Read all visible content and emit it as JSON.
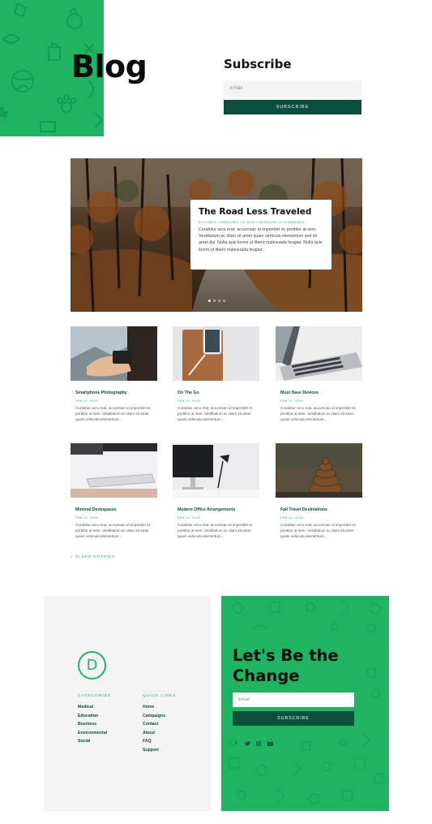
{
  "header": {
    "page_title": "Blog",
    "subscribe": {
      "title": "Subscribe",
      "email_placeholder": "Email",
      "button_label": "SUBSCRIBE"
    }
  },
  "featured": {
    "title": "The Road Less Traveled",
    "meta": "BY ETREX | FEBRUARY 13, 2019 | OUTDOOR | 0 COMMENTS",
    "excerpt": "Curabitur arcu erat, accumsan id imperdiet et, porttitor at sem. Vestibulum ac diam sit amet quam vehicula elementum sed sit amet dui. Nulla quis lorem ut libero malesuada feugiat. Nulla quis lorem ut libero malesuada feugiat.",
    "slides": 4,
    "active_slide": 1
  },
  "posts": [
    {
      "title": "Smartphone Photography",
      "date": "FEB 13, 2019",
      "excerpt": "Curabitur arcu erat, accumsan id imperdiet et, porttitor at sem. Vestibulum ac diam sit amet quam vehicula elementum..."
    },
    {
      "title": "On The Go",
      "date": "FEB 13, 2019",
      "excerpt": "Curabitur arcu erat, accumsan id imperdiet et, porttitor at sem. Vestibulum ac diam sit amet quam vehicula elementum..."
    },
    {
      "title": "Must Have Devices",
      "date": "FEB 13, 2019",
      "excerpt": "Curabitur arcu erat, accumsan id imperdiet et, porttitor at sem. Vestibulum ac diam sit amet quam vehicula elementum..."
    },
    {
      "title": "Minimal Deskspaces",
      "date": "FEB 13, 2019",
      "excerpt": "Curabitur arcu erat, accumsan id imperdiet et, porttitor at sem. Vestibulum ac diam sit amet quam vehicula elementum..."
    },
    {
      "title": "Modern Office Arrangements",
      "date": "FEB 13, 2019",
      "excerpt": "Curabitur arcu erat, accumsan id imperdiet et, porttitor at sem. Vestibulum ac diam sit amet quam vehicula elementum..."
    },
    {
      "title": "Fall Travel Destinations",
      "date": "FEB 13, 2019",
      "excerpt": "Curabitur arcu erat, accumsan id imperdiet et, porttitor at sem. Vestibulum ac diam sit amet quam vehicula elementum..."
    }
  ],
  "older_entries": "« OLDER ENTRIES",
  "footer": {
    "logo_letter": "D",
    "categories": {
      "heading": "CATEGORIES",
      "items": [
        "Medical",
        "Education",
        "Business",
        "Environmental",
        "Social"
      ]
    },
    "quick_links": {
      "heading": "QUICK LINKS",
      "items": [
        "Home",
        "Campaigns",
        "Contact",
        "About",
        "FAQ",
        "Support"
      ]
    },
    "cta": {
      "title": "Let's Be the Change",
      "email_placeholder": "Email",
      "button_label": "SUBSCRIBE"
    },
    "social_icons": [
      "facebook-icon",
      "twitter-icon",
      "instagram-icon",
      "youtube-icon"
    ]
  },
  "colors": {
    "brand_green": "#1fb462",
    "dark_green": "#0b4f3d",
    "light_gray": "#f4f4f4"
  }
}
